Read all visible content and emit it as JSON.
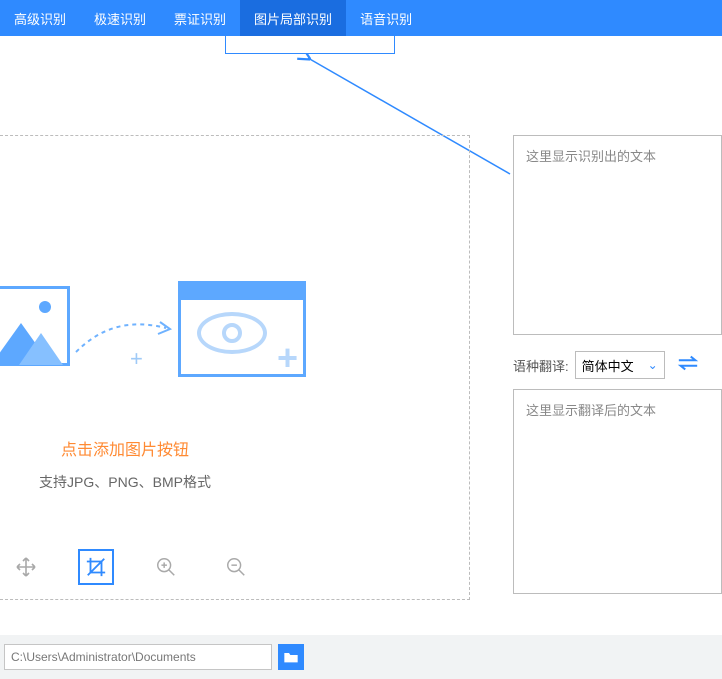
{
  "tabs": {
    "t0": "高级识别",
    "t1": "极速识别",
    "t2": "票证识别",
    "t3": "图片局部识别",
    "t4": "语音识别"
  },
  "left": {
    "click": "点击添加图片按钮",
    "support": "支持JPG、PNG、BMP格式"
  },
  "right": {
    "placeholder_text": "这里显示识别出的文本",
    "translate_label": "语种翻译:",
    "lang_selected": "简体中文",
    "placeholder_trans": "这里显示翻译后的文本"
  },
  "bottom": {
    "path": "C:\\Users\\Administrator\\Documents"
  }
}
